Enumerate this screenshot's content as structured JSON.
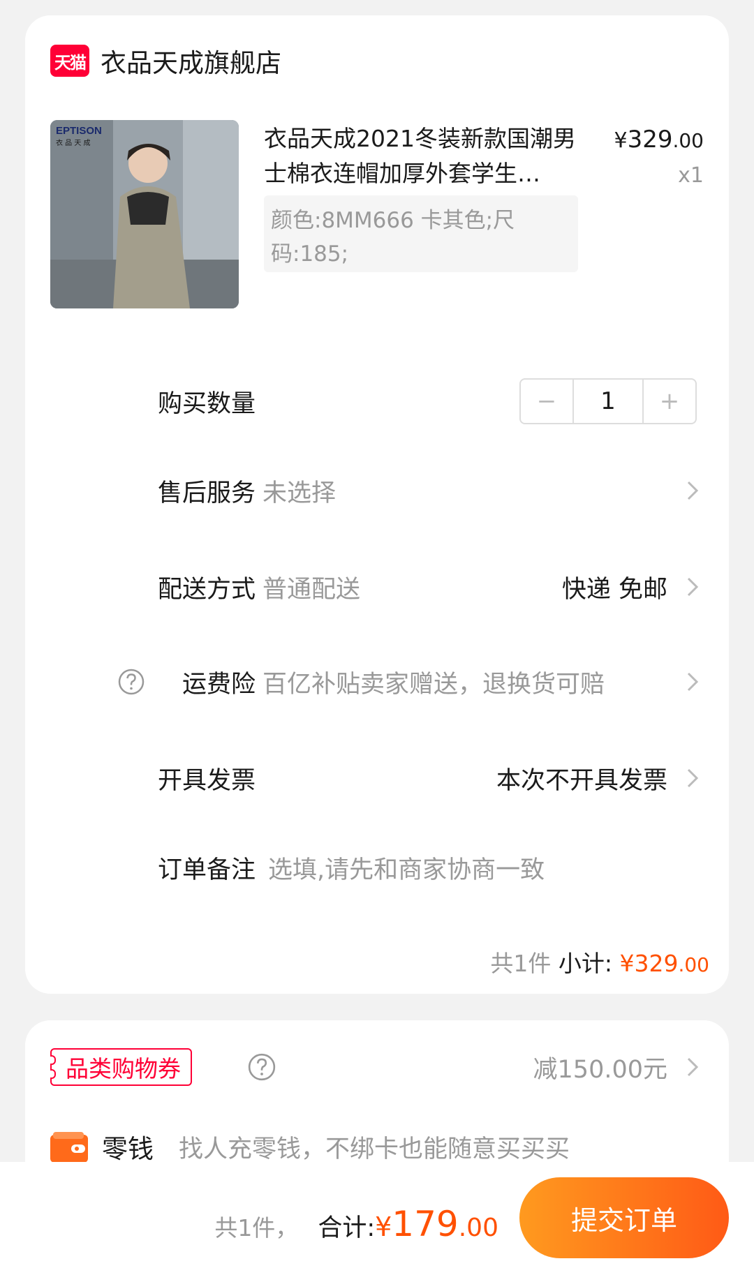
{
  "shop": {
    "logo_text": "天猫",
    "name": "衣品天成旗舰店"
  },
  "product": {
    "title": "衣品天成2021冬装新款国潮男士棉衣连帽加厚外套学生…",
    "sku": "颜色:8MM666 卡其色;尺码:185;",
    "image_brand": "EPTISON",
    "image_brand_sub": "衣 品 天 成",
    "price": {
      "currency": "¥",
      "integer": "329",
      "decimal": ".00"
    },
    "quantity_label": "x1"
  },
  "quantity": {
    "label": "购买数量",
    "value": "1",
    "minus": "−",
    "plus": "+"
  },
  "after_sales": {
    "label": "售后服务",
    "value": "未选择"
  },
  "delivery": {
    "label": "配送方式",
    "value": "普通配送",
    "right": "快递 免邮"
  },
  "shipping_insurance": {
    "label": "运费险",
    "value": "百亿补贴卖家赠送，退换货可赔"
  },
  "invoice": {
    "label": "开具发票",
    "right": "本次不开具发票"
  },
  "note": {
    "label": "订单备注",
    "placeholder": "选填,请先和商家协商一致"
  },
  "subtotal": {
    "count": "共1件",
    "label": "小计:",
    "currency": "¥",
    "integer": "329",
    "decimal": ".00"
  },
  "coupon": {
    "label": "品类购物券",
    "value": "减150.00元"
  },
  "wallet": {
    "label": "零钱",
    "desc": "找人充零钱，不绑卡也能随意买买买"
  },
  "footer": {
    "count": "共1件，",
    "label": "合计:",
    "currency": "¥",
    "integer": "179",
    "decimal": ".00",
    "submit": "提交订单"
  },
  "colors": {
    "accent": "#ff5000",
    "tmall_red": "#ff0036",
    "button_start": "#ff9a1f",
    "button_end": "#ff5a16"
  }
}
